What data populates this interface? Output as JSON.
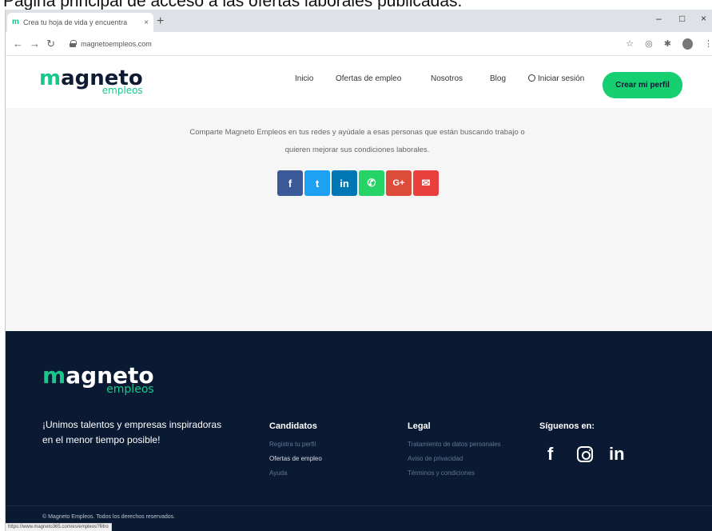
{
  "caption": "Página principal de acceso a las ofertas laborales publicadas.",
  "browser": {
    "tab_favicon": "m",
    "tab_title": "Crea tu hoja de vida y encuentra",
    "tab_close": "×",
    "new_tab": "+",
    "url": "magnetoempleos.com",
    "window_controls": [
      "–",
      "□",
      "×"
    ]
  },
  "header": {
    "logo_m": "m",
    "logo_rest": "agneto",
    "logo_sub": "empleos",
    "nav": [
      "Inicio",
      "Ofertas de empleo",
      "Nosotros",
      "Blog"
    ],
    "login_label": "Iniciar sesión",
    "cta_label": "Crear mi perfil"
  },
  "share": {
    "text_line1": "Comparte Magneto Empleos en tus redes y ayúdale a esas personas que están buscando trabajo o",
    "text_line2": "quieren mejorar sus condiciones laborales.",
    "buttons": [
      {
        "glyph": "f",
        "icon": "facebook-icon",
        "color": "#3b5998"
      },
      {
        "glyph": "t",
        "icon": "twitter-icon",
        "color": "#1da1f2"
      },
      {
        "glyph": "in",
        "icon": "linkedin-icon",
        "color": "#0077b5"
      },
      {
        "glyph": "✆",
        "icon": "whatsapp-icon",
        "color": "#25d366"
      },
      {
        "glyph": "G+",
        "icon": "google-plus-icon",
        "color": "#dd4b39"
      },
      {
        "glyph": "✉",
        "icon": "email-icon",
        "color": "#e8413d"
      }
    ]
  },
  "footer": {
    "logo_m": "m",
    "logo_rest": "agneto",
    "logo_sub": "empleos",
    "tagline": "¡Unimos talentos y empresas inspiradoras en el menor tiempo posible!",
    "candidatos": {
      "heading": "Candidatos",
      "links": [
        "Registra tu perfil",
        "Ofertas de empleo",
        "Ayuda"
      ]
    },
    "legal": {
      "heading": "Legal",
      "links": [
        "Tratamiento de datos personales",
        "Aviso de privacidad",
        "Términos y condiciones"
      ]
    },
    "social": {
      "heading": "Síguenos en:",
      "facebook": "f",
      "linkedin": "in"
    },
    "copyright": "© Magneto Empleos. Todos los derechos reservados."
  },
  "status_url": "https://www.magneto365.com/es/empleos?filtro"
}
